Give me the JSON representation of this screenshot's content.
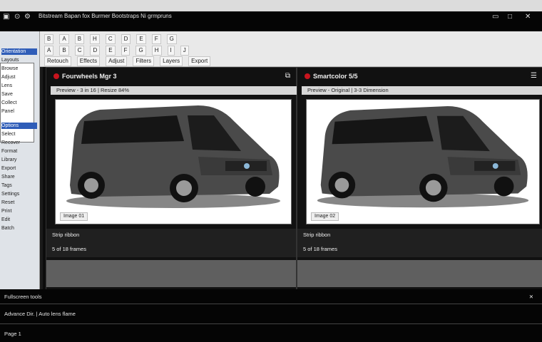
{
  "window": {
    "title_icons": [
      "window-icon",
      "zoom-icon",
      "settings-icon"
    ],
    "controls": [
      "minimize",
      "maximize",
      "close"
    ]
  },
  "topbar": {
    "path": "Bitstream Bapan fox Burmer Bootstraps Ni grmpruns"
  },
  "ribbon": {
    "row1": [
      "B",
      "A",
      "B",
      "H",
      "C",
      "D",
      "E",
      "F",
      "G"
    ],
    "row2": [
      "A",
      "B",
      "C",
      "D",
      "E",
      "F",
      "G",
      "H",
      "I",
      "J"
    ],
    "row3": [
      "Retouch",
      "Effects",
      "Adjust",
      "Filters",
      "Layers",
      "Export"
    ]
  },
  "sidebar": {
    "items": [
      "Orientation",
      "Layouts",
      "Browse",
      "Adjust",
      "Lens",
      "Save",
      "Collect",
      "Panel",
      "Options",
      "Select",
      "Recover",
      "Format",
      "Library",
      "Export",
      "Share",
      "Tags",
      "Settings",
      "Reset",
      "Print",
      "Edit",
      "Batch"
    ]
  },
  "viewers": [
    {
      "title": "Fourwheels Mgr 3",
      "subtitle": "Preview - 3 in 16 | Resize 84%",
      "caption": "Image 01",
      "footer1": "Strip ribbon",
      "footer2": "5 of 18 frames"
    },
    {
      "title": "Smartcolor 5/5",
      "subtitle": "Preview - Original | 3-3 Dimension",
      "caption": "Image 02",
      "footer1": "Strip ribbon",
      "footer2": "5 of 18 frames"
    }
  ],
  "bottombar": {
    "line1": "Fullscreen tools",
    "line2": "Advance Dir. | Auto lens flame",
    "line3": "Page 1"
  }
}
